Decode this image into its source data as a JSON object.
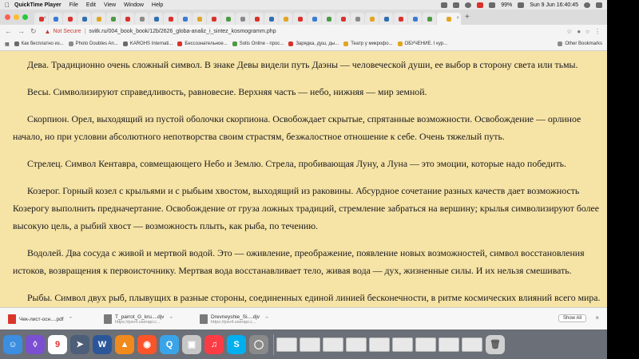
{
  "menubar": {
    "app": "QuickTime Player",
    "items": [
      "File",
      "Edit",
      "View",
      "Window",
      "Help"
    ],
    "battery": "99%",
    "clock": "Sun 9 Jun  16:40:45"
  },
  "browser": {
    "not_secure": "Not Secure",
    "url": "svitk.ru/004_book_book/12b/2626_globa-analiz_i_sintez_kosmogramm.php",
    "bookmarks": [
      "Как бесплатно из...",
      "Photo Doubles An...",
      "KAROHS Internati...",
      "Бессознательное...",
      "Sotis Online - прос...",
      "Зарядка, душ, ды...",
      "Театр у микрофо...",
      "ОБУЧЕНИЕ. I кур..."
    ],
    "other_bookmarks": "Other Bookmarks"
  },
  "article": {
    "paragraphs": [
      "Дева. Традиционно очень сложный символ. В знаке Девы видели путь Даэны — человеческой души, ее выбор в сторону света или тьмы.",
      "Весы. Символизируют справедливость, равновесие. Верхняя часть — небо, нижняя — мир земной.",
      "Скорпион. Орел, выходящий из пустой оболочки скорпиона. Освобождает скрытые, спрятанные возможности. Освобождение — орлиное начало, но при условии абсолютного непотворства своим страстям, безжалостное отношение к себе. Очень тяжелый путь.",
      "Стрелец. Символ Кентавра, совмещающего Небо и Землю. Стрела, пробивающая Луну, а Луна — это эмоции, которые надо победить.",
      "Козерог. Горный козел с крыльями и с рыбьим хвостом, выходящий из раковины. Абсурдное сочетание разных качеств дает возможность Козерогу выполнить предначертание. Освобождение от груза ложных традиций, стремление забраться на вершину; крылья символизируют более высокую цель, а рыбий хвост — возможность плыть, как рыба, по течению.",
      "Водолей. Два сосуда с живой и мертвой водой. Это — оживление, преображение, появление новых возможностей, символ восстановления истоков, возвращения к первоисточнику. Мертвая вода восстанавливает тело, живая вода — дух, жизненные силы. И их нельзя смешивать.",
      "Рыбы. Символ двух рыб, плывущих в разные стороны, соединенных единой линией бесконечности, в ритме космических влияний всего мира. Слияние с миром идеалов, обретение высшего смысла жизни."
    ]
  },
  "downloads": {
    "items": [
      {
        "name": "Чек-лист-осн....pdf",
        "sub": "",
        "color": "#d9362b"
      },
      {
        "name": "T_parrot_G_kru....djv",
        "sub": "https://psv4.userapi.c...",
        "color": "#7a7a7a"
      },
      {
        "name": "Drevneyshie_Si....djv",
        "sub": "https://psv4.userapi.c...",
        "color": "#7a7a7a"
      }
    ],
    "show_all": "Show All"
  },
  "dock": {
    "calendar_day": "9",
    "word_letter": "W",
    "skype_letter": "S"
  },
  "colors": {
    "page_bg": "#f6e3a6",
    "text": "#1a1a1a",
    "not_secure": "#c43b32"
  }
}
